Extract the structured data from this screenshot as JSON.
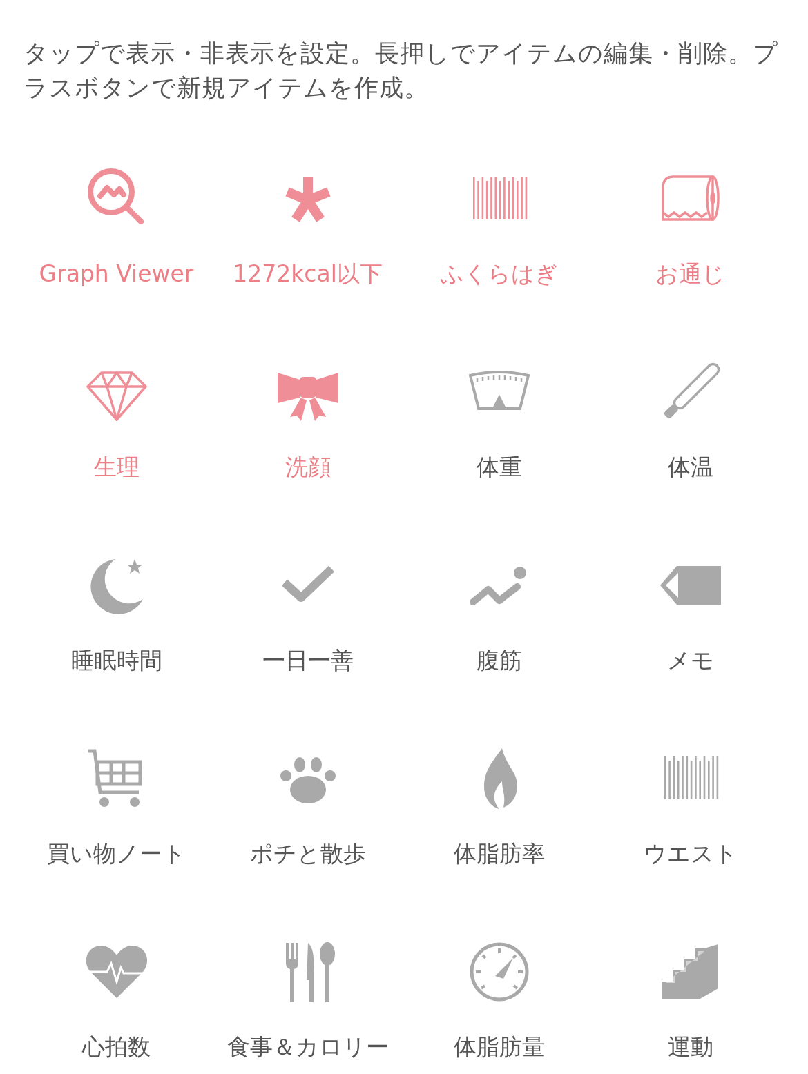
{
  "instructions": "タップで表示・非表示を設定。長押しでアイテムの編集・削除。プラスボタンで新規アイテムを作成。",
  "items": [
    {
      "label": "Graph Viewer",
      "visible": true
    },
    {
      "label": "1272kcal以下",
      "visible": true
    },
    {
      "label": "ふくらはぎ",
      "visible": true
    },
    {
      "label": "お通じ",
      "visible": true
    },
    {
      "label": "生理",
      "visible": true
    },
    {
      "label": "洗顔",
      "visible": true
    },
    {
      "label": "体重",
      "visible": false
    },
    {
      "label": "体温",
      "visible": false
    },
    {
      "label": "睡眠時間",
      "visible": false
    },
    {
      "label": "一日一善",
      "visible": false
    },
    {
      "label": "腹筋",
      "visible": false
    },
    {
      "label": "メモ",
      "visible": false
    },
    {
      "label": "買い物ノート",
      "visible": false
    },
    {
      "label": "ポチと散歩",
      "visible": false
    },
    {
      "label": "体脂肪率",
      "visible": false
    },
    {
      "label": "ウエスト",
      "visible": false
    },
    {
      "label": "心拍数",
      "visible": false
    },
    {
      "label": "食事＆カロリー",
      "visible": false
    },
    {
      "label": "体脂肪量",
      "visible": false
    },
    {
      "label": "運動",
      "visible": false
    }
  ]
}
